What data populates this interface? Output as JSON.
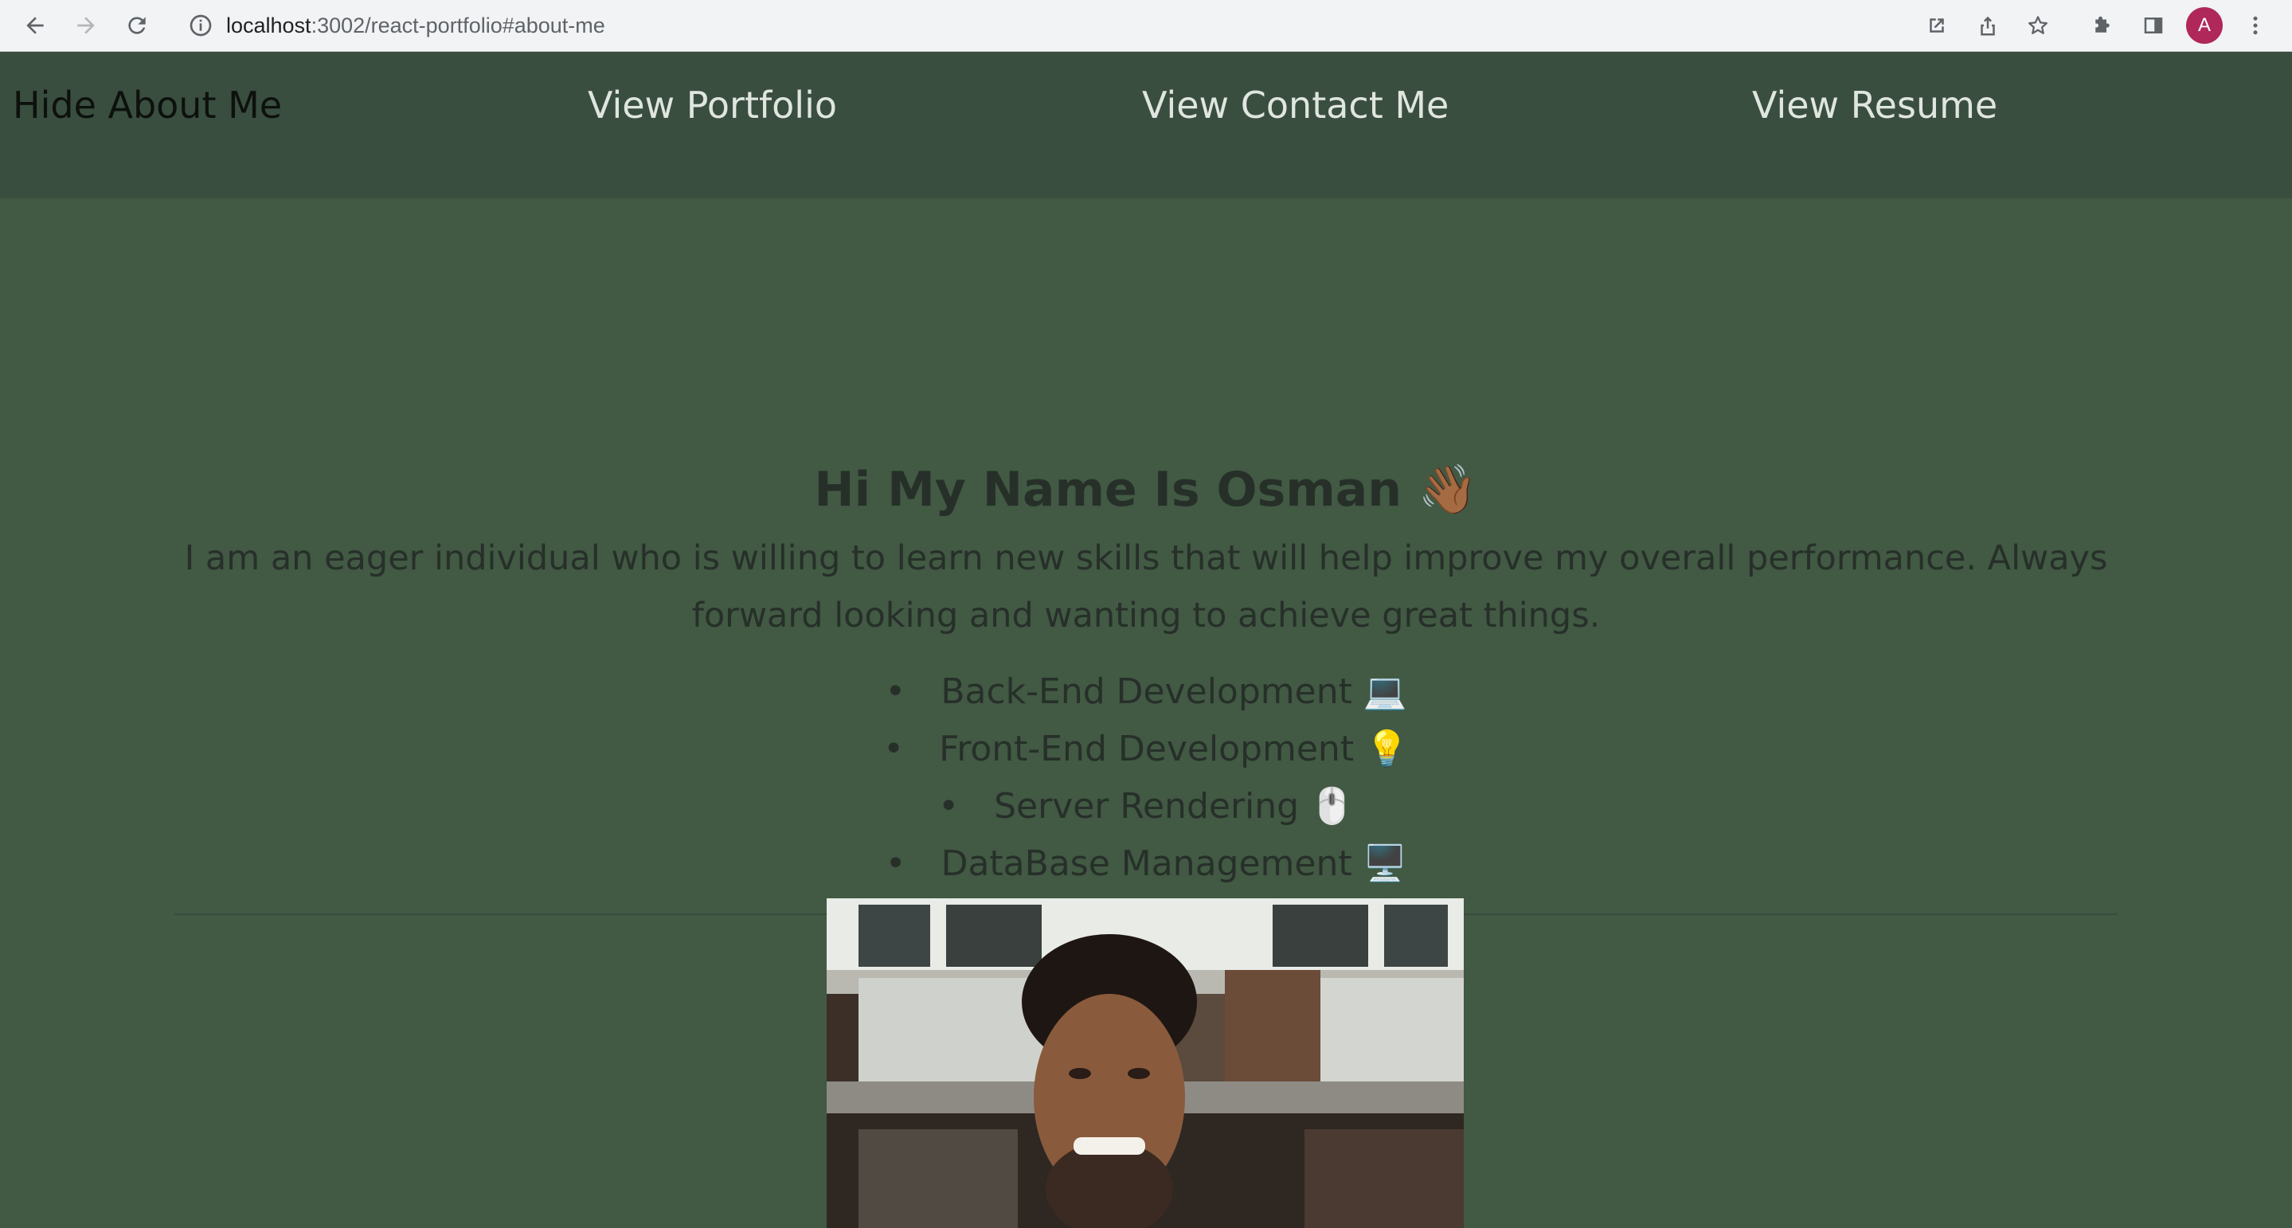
{
  "browser": {
    "url_host": "localhost",
    "url_path": ":3002/react-portfolio#about-me",
    "profile_initial": "A",
    "icons": [
      "back-arrow-icon",
      "forward-arrow-icon",
      "reload-icon",
      "info-icon",
      "open-in-new-icon",
      "share-icon",
      "star-icon",
      "puzzle-icon",
      "side-panel-icon",
      "kebab-menu-icon"
    ]
  },
  "nav": {
    "about": "Hide About Me",
    "portfolio": "View Portfolio",
    "contact": "View Contact Me",
    "resume": "View Resume"
  },
  "about": {
    "heading": "Hi My Name Is Osman 👋🏾",
    "bio": "I am an eager individual who is willing to learn new skills that will help improve my overall performance. Always forward looking and wanting to achieve great things.",
    "skills": [
      "Back-End Development 💻",
      "Front-End Development 💡",
      "Server Rendering 🖱️",
      "DataBase Management 🖥️"
    ],
    "bullet": "•"
  },
  "colors": {
    "page_bg": "#425944",
    "nav_bg": "#3a4e40",
    "nav_text": "#dfe6df",
    "active_nav_text": "#0d110d",
    "body_text": "#263029",
    "avatar": "#b0275a"
  }
}
